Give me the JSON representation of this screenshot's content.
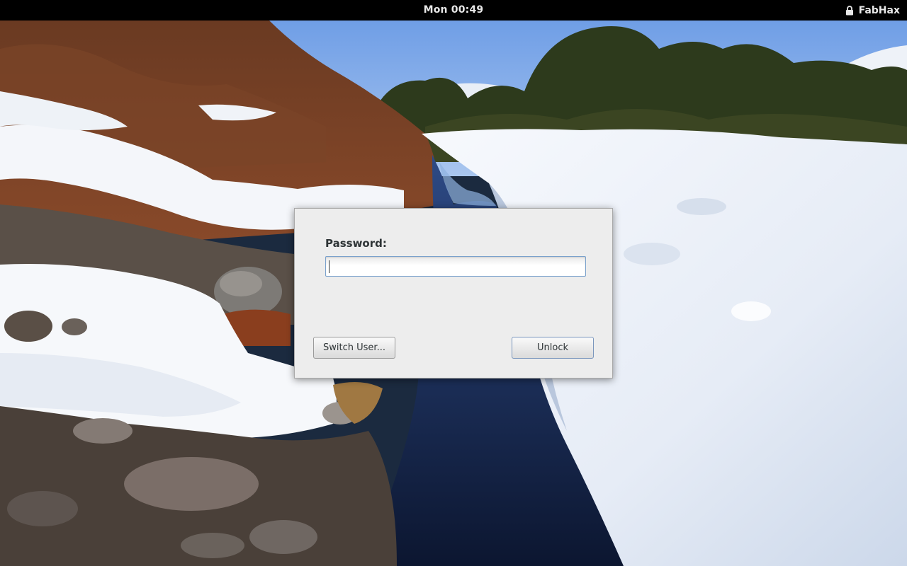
{
  "topbar": {
    "clock": "Mon 00:49",
    "username": "FabHax",
    "lock_icon": "lock-icon"
  },
  "dialog": {
    "password_label": "Password:",
    "password_value": "",
    "switch_user_label": "Switch User...",
    "unlock_label": "Unlock"
  },
  "colors": {
    "topbar_bg": "#000000",
    "dialog_bg": "#ededed",
    "input_focus_border": "#7aa1cc"
  }
}
